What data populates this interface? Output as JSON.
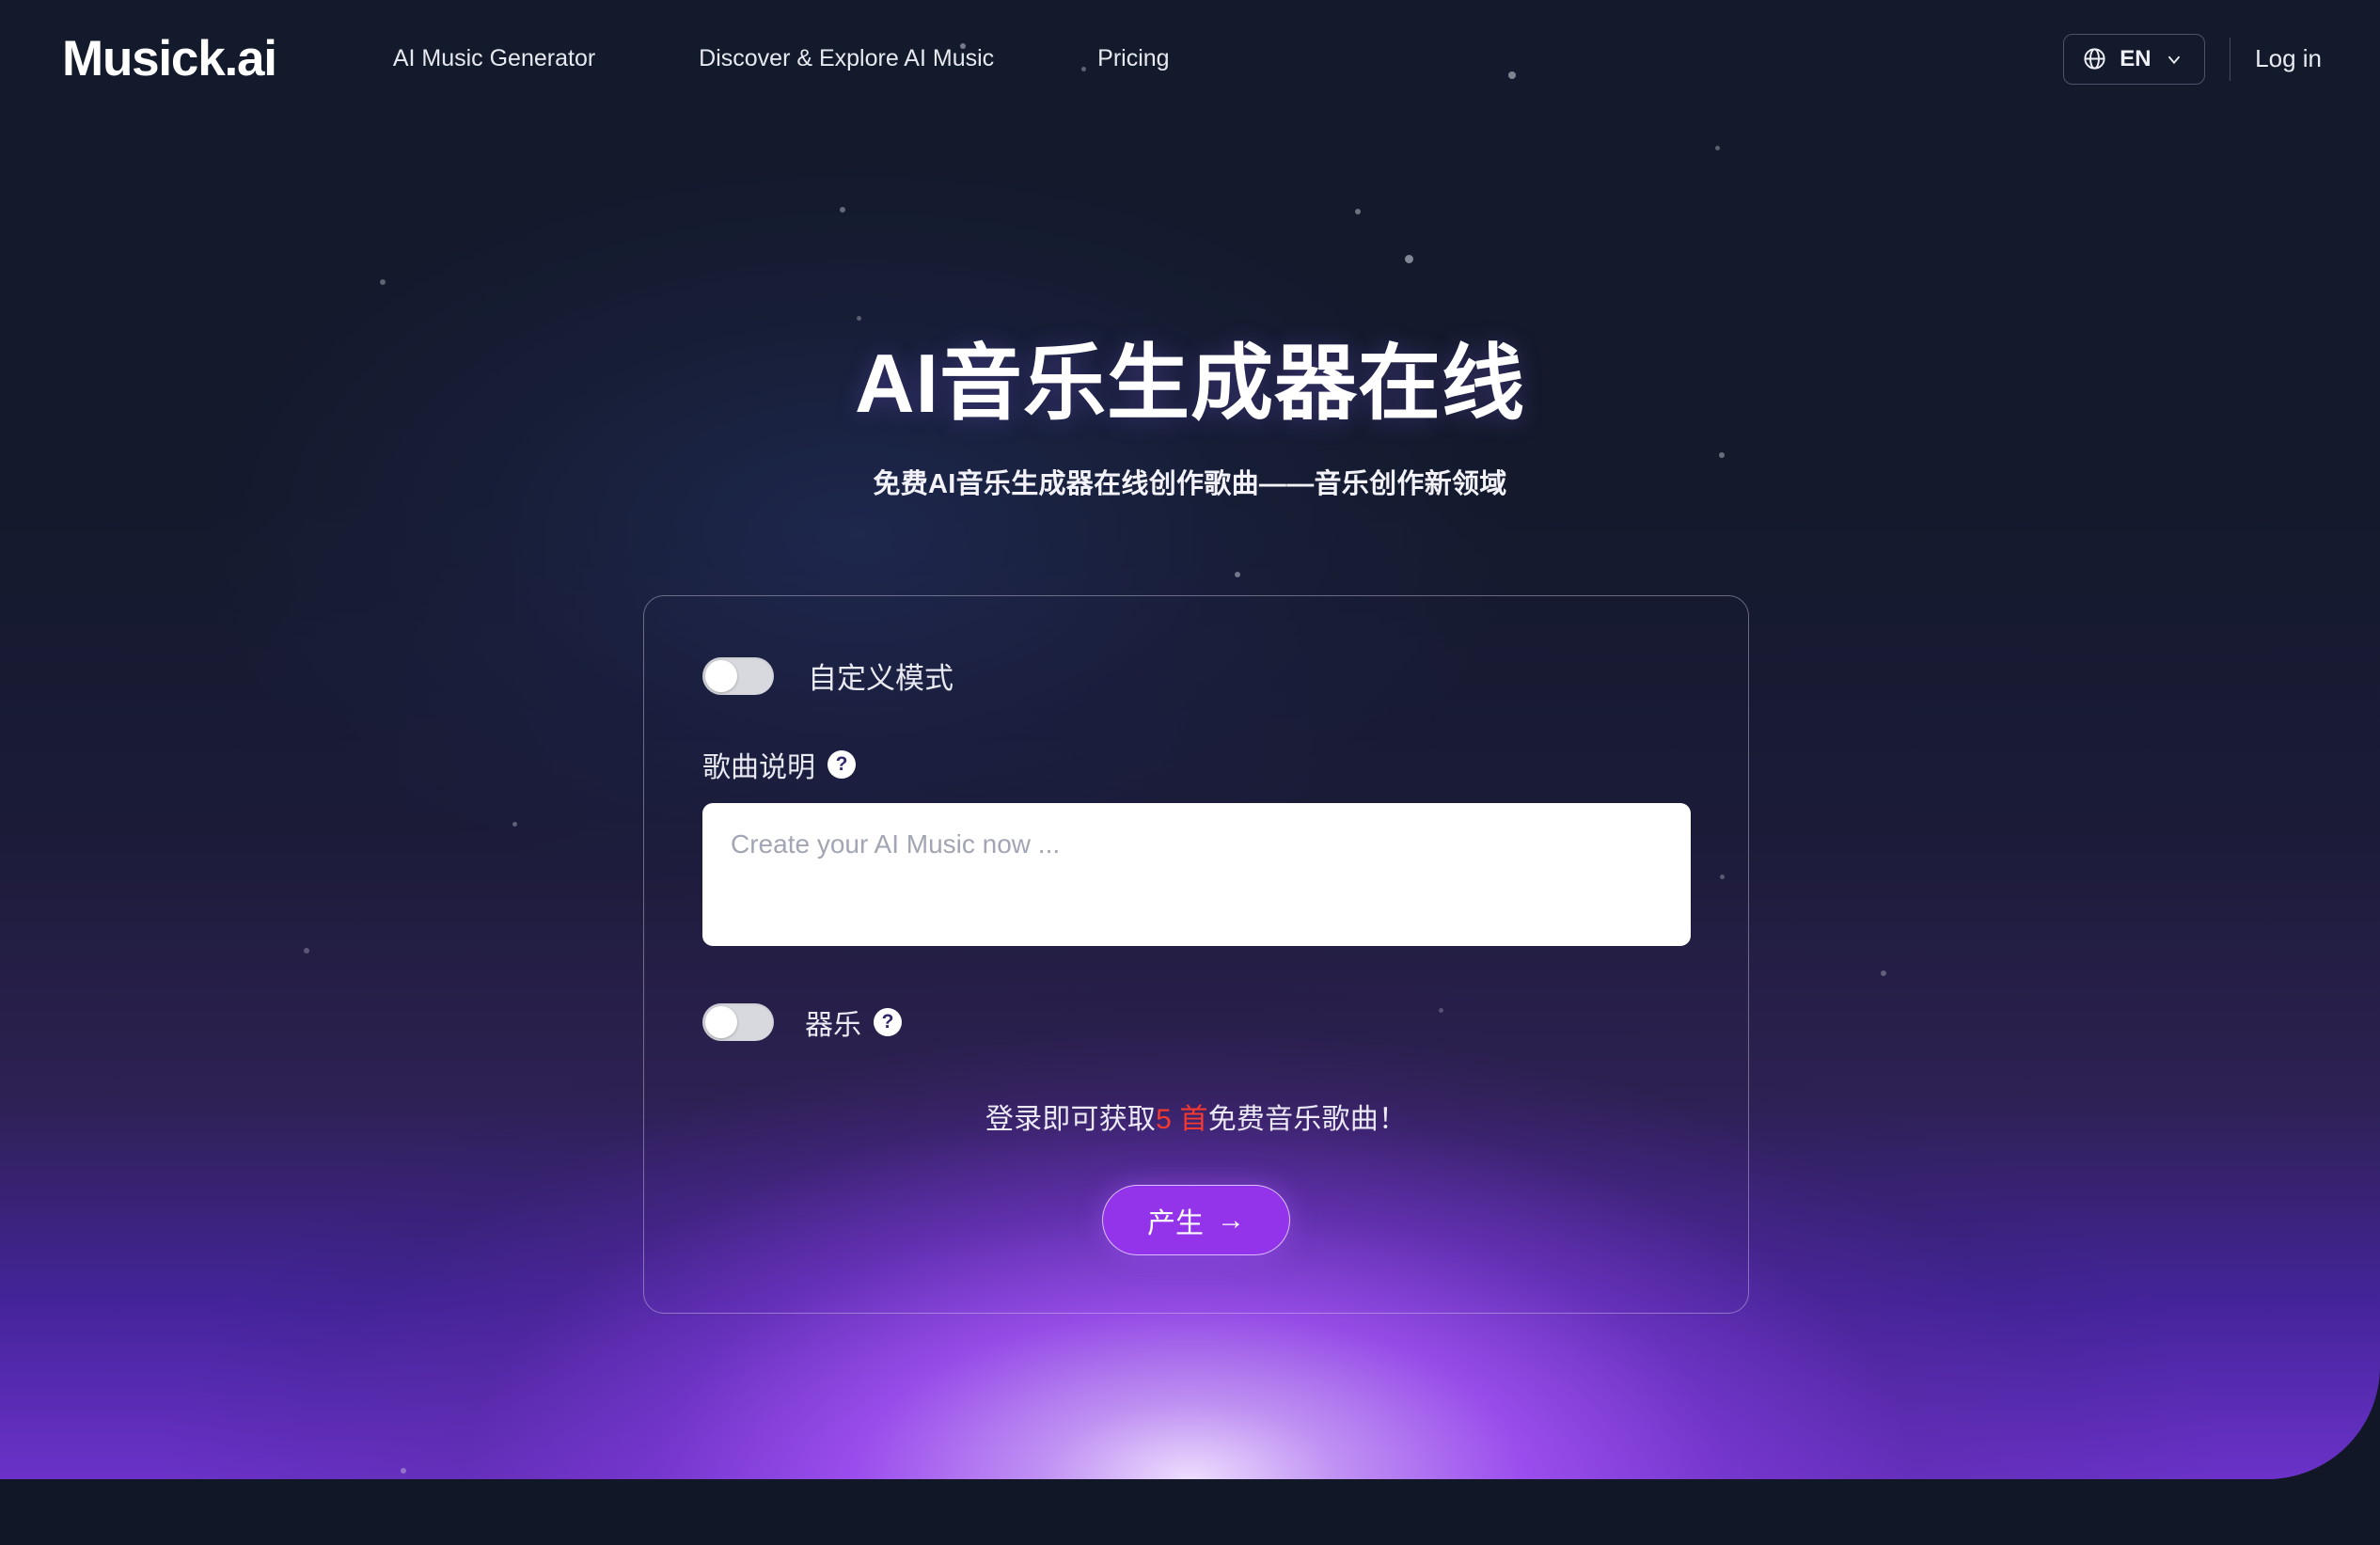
{
  "brand": {
    "logo": "Musick.ai"
  },
  "nav": {
    "links": [
      {
        "label": "AI Music Generator"
      },
      {
        "label": "Discover & Explore AI Music"
      },
      {
        "label": "Pricing"
      }
    ],
    "language": {
      "code": "EN",
      "icon": "globe-icon",
      "chevron": "chevron-down-icon"
    },
    "login": "Log in"
  },
  "hero": {
    "headline": "AI音乐生成器在线",
    "subheadline": "免费AI音乐生成器在线创作歌曲——音乐创作新领域"
  },
  "form": {
    "custom_mode": {
      "label": "自定义模式",
      "state": "off"
    },
    "song_description": {
      "label": "歌曲说明",
      "help_icon": "question-mark-icon",
      "value": "",
      "placeholder": "Create your AI Music now ..."
    },
    "instrumental": {
      "label": "器乐",
      "help_icon": "question-mark-icon",
      "state": "off"
    },
    "promo": {
      "prefix": "登录即可获取",
      "highlight": "5 首",
      "suffix": "免费音乐歌曲！",
      "highlight_color": "#f5392f"
    },
    "generate_button": {
      "label": "产生",
      "arrow": "→"
    }
  },
  "colors": {
    "page_background": "#111726",
    "accent_purple": "#9333ea",
    "glow": "#d9b6ff",
    "text_light": "#e9eaf2"
  }
}
